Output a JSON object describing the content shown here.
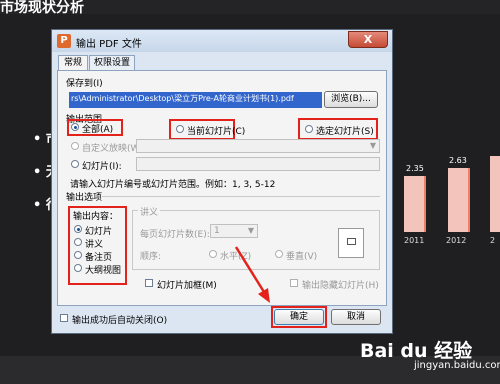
{
  "slide": {
    "title": "市场现状分析",
    "bullets": [
      "市",
      "无",
      "行"
    ],
    "bar_labels": [
      "2.35",
      "2.63"
    ],
    "axis_labels": [
      "2011",
      "2012",
      "2"
    ]
  },
  "watermark": {
    "brand": "Bai du 经验",
    "sub": "jingyan.baidu.com"
  },
  "dialog": {
    "title": "输出 PDF 文件",
    "close_label": "X",
    "tabs": [
      "常规",
      "权限设置"
    ],
    "save_to_label": "保存到(I)",
    "save_path": "rs\\Administrator\\Desktop\\梁立万Pre-A轮商业计划书(1).pdf",
    "browse_label": "浏览(B)...",
    "output_range_label": "输出范围",
    "range_all": "全部(A)",
    "range_current": "当前幻灯片(C)",
    "range_selected": "选定幻灯片(S)",
    "custom_show": "自定义放映(W):",
    "slides_label": "幻灯片(I):",
    "range_hint": "请输入幻灯片编号或幻灯片范围。例如：1, 3, 5-12",
    "output_options_label": "输出选项",
    "content_label": "输出内容：",
    "content_options": [
      "幻灯片",
      "讲义",
      "备注页",
      "大纲视图"
    ],
    "handout_label": "讲义",
    "per_page_label": "每页幻灯片数(E):",
    "per_page_value": "1",
    "order_label": "顺序:",
    "order_horizontal": "水平(Z)",
    "order_vertical": "垂直(V)",
    "frame_label": "幻灯片加框(M)",
    "hidden_label": "输出隐藏幻灯片(H)",
    "auto_close_label": "输出成功后自动关闭(O)",
    "ok_label": "确定",
    "cancel_label": "取消"
  },
  "annotation_color": "#e3231b"
}
